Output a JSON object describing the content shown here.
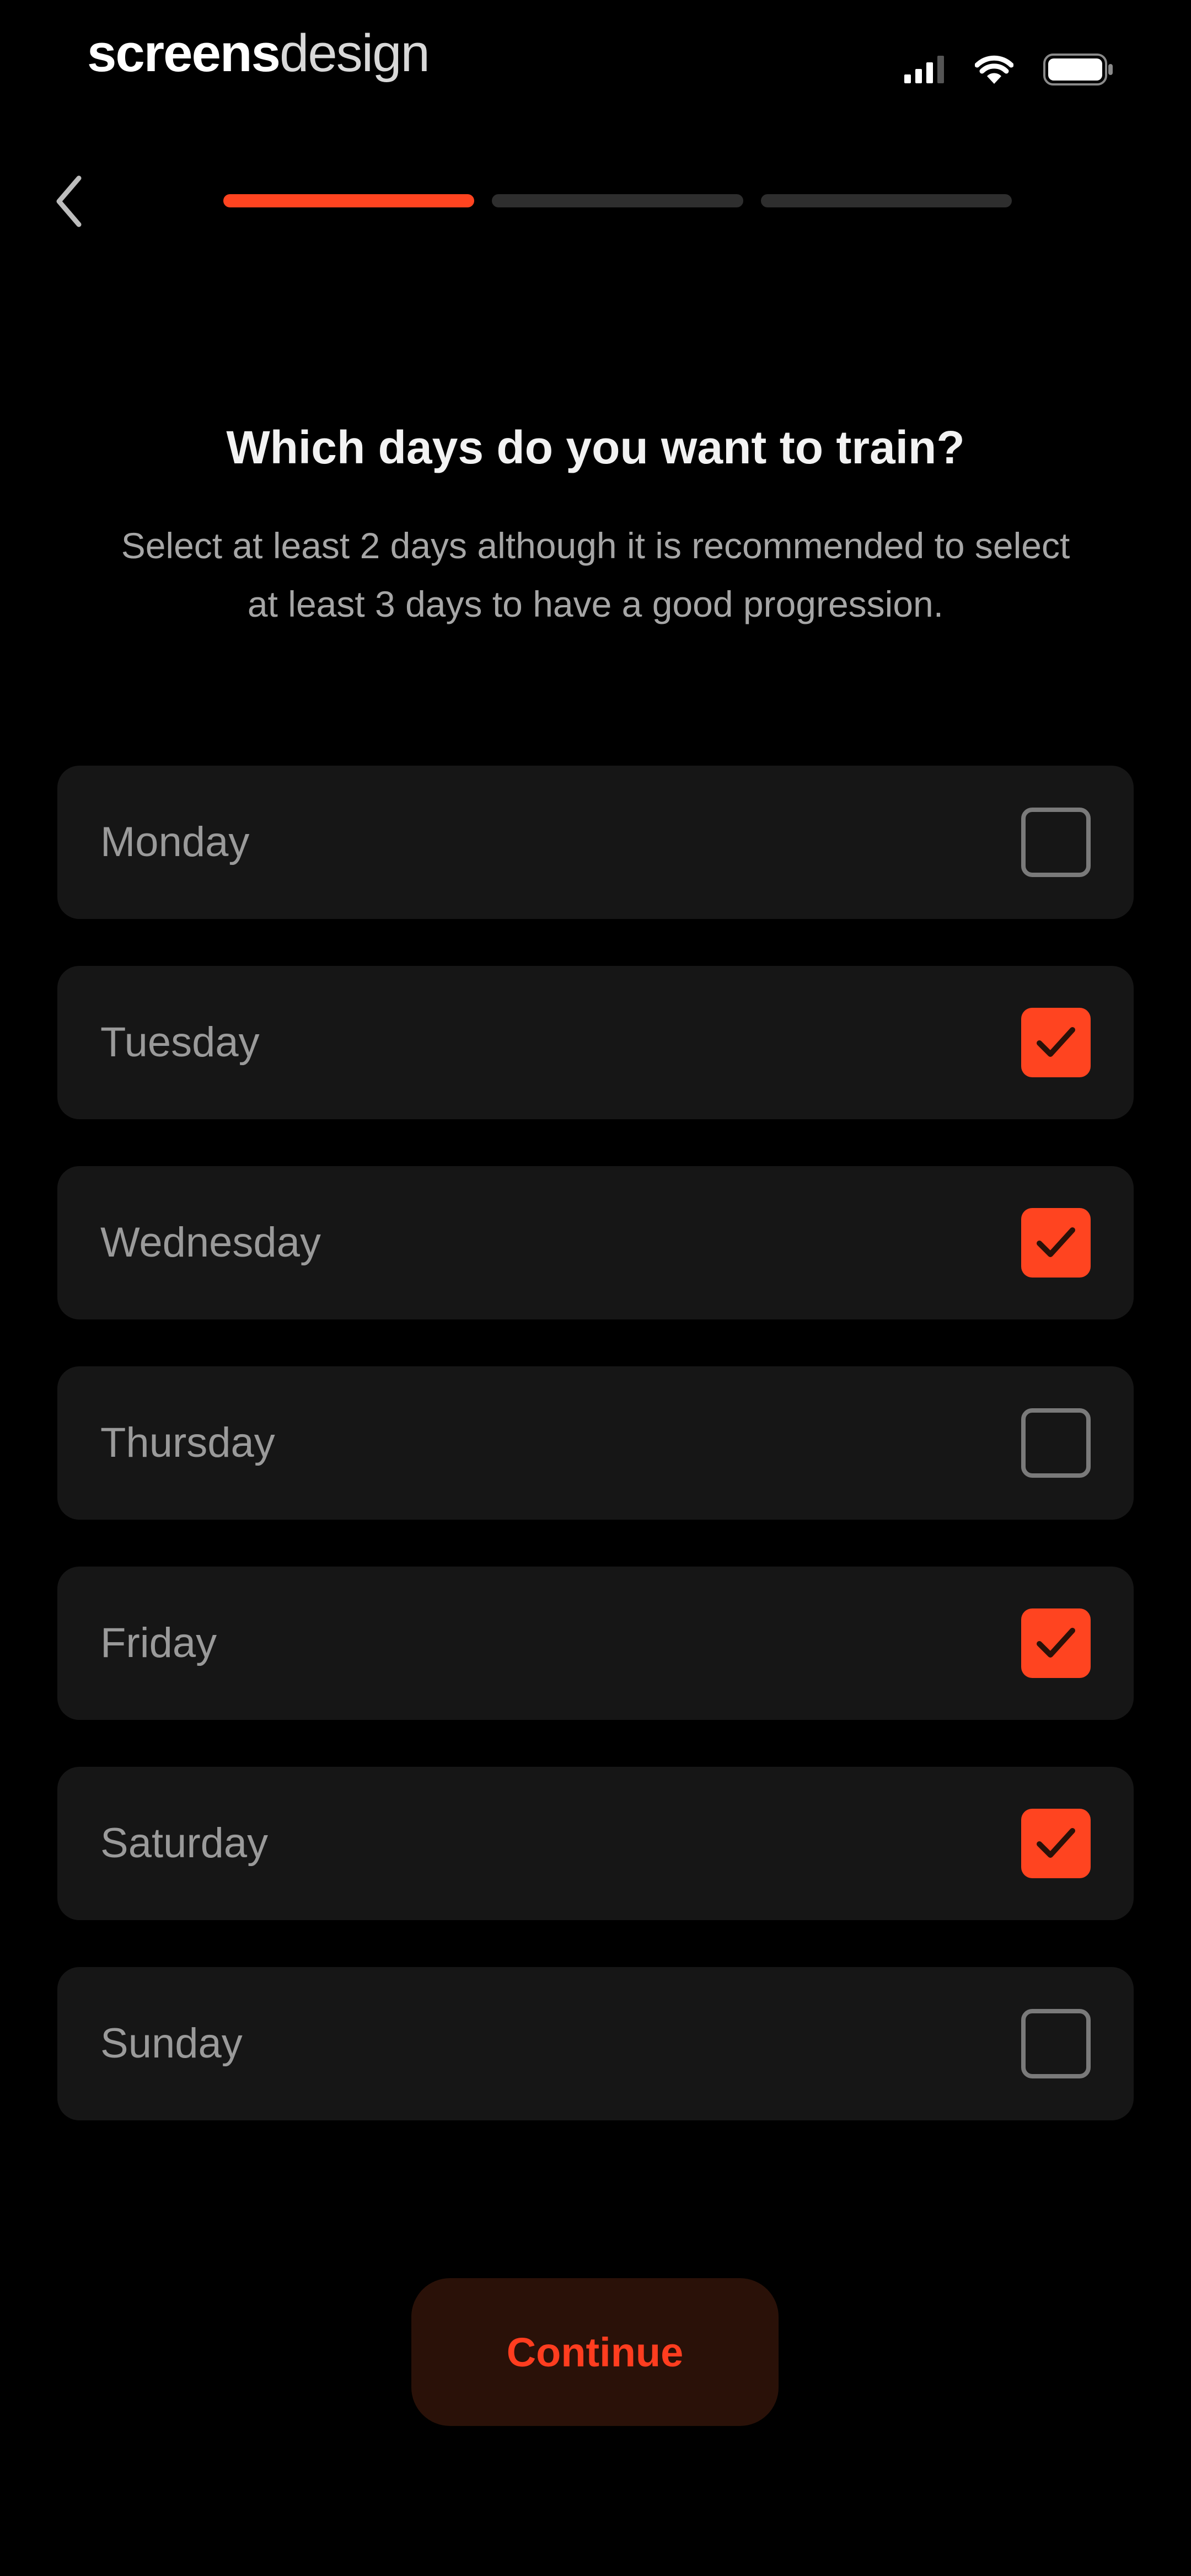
{
  "status_bar": {
    "brand_bold": "screens",
    "brand_light": "design",
    "icons": [
      "signal-icon",
      "wifi-icon",
      "battery-icon"
    ]
  },
  "nav": {
    "back_icon": "chevron-left-icon",
    "progress_steps_total": 3,
    "progress_step_current": 1
  },
  "content": {
    "title": "Which days do you want to train?",
    "subtitle": "Select at least 2 days although it is recommended to select at least 3 days to have a good progression."
  },
  "days": [
    {
      "label": "Monday",
      "checked": false
    },
    {
      "label": "Tuesday",
      "checked": true
    },
    {
      "label": "Wednesday",
      "checked": true
    },
    {
      "label": "Thursday",
      "checked": false
    },
    {
      "label": "Friday",
      "checked": true
    },
    {
      "label": "Saturday",
      "checked": true
    },
    {
      "label": "Sunday",
      "checked": false
    }
  ],
  "actions": {
    "continue_label": "Continue"
  },
  "colors": {
    "background": "#000000",
    "card": "#161616",
    "accent": "#ff4420",
    "progress_inactive": "#2e2e2e",
    "button_bg": "#2a1108",
    "button_text": "#ff3d1f"
  }
}
